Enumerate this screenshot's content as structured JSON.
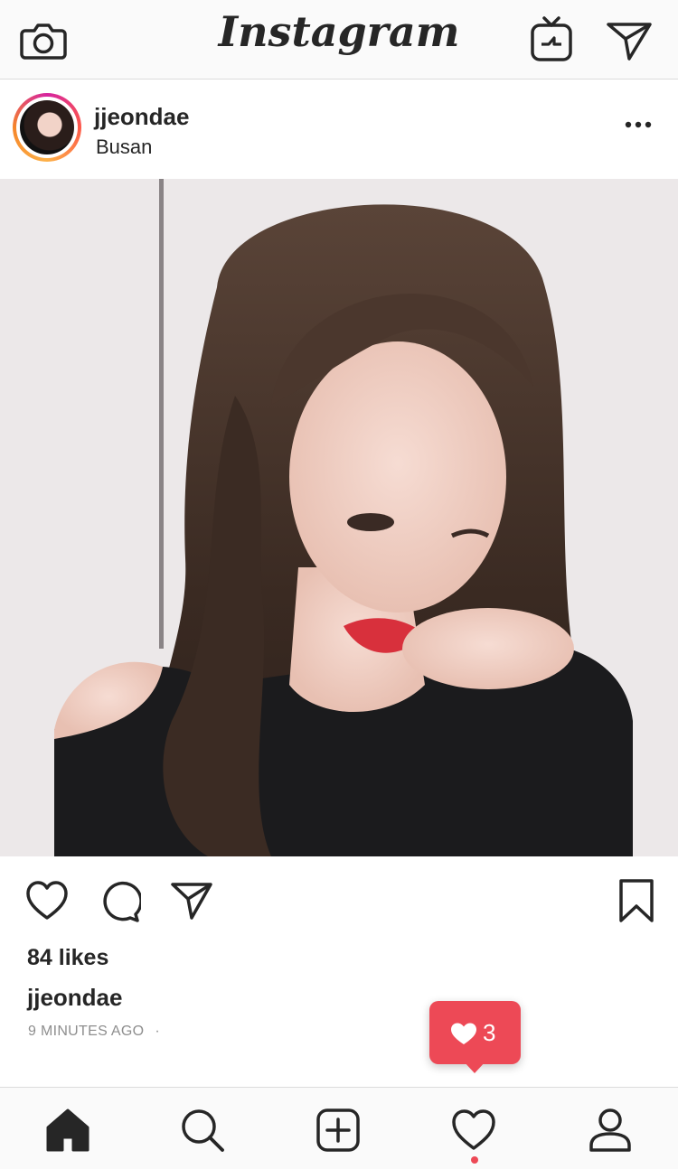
{
  "app": {
    "title": "Instagram"
  },
  "topbar": {
    "icons": [
      "camera-icon",
      "igtv-icon",
      "direct-message-icon"
    ]
  },
  "post": {
    "username": "jjeondae",
    "location": "Busan",
    "likes_text": "84 likes",
    "caption_username": "jjeondae",
    "time_ago": "9 MINUTES AGO",
    "time_separator": "·",
    "actions": [
      "like-icon",
      "comment-icon",
      "share-icon",
      "bookmark-icon"
    ]
  },
  "notification": {
    "icon": "heart-icon",
    "count": "3"
  },
  "tabbar": {
    "items": [
      "home-icon",
      "search-icon",
      "add-post-icon",
      "activity-heart-icon",
      "profile-icon"
    ],
    "active": "home-icon"
  },
  "colors": {
    "notification_red": "#ed4956",
    "text": "#262626",
    "muted": "#8e8e8e",
    "bar_bg": "#fafafa"
  }
}
